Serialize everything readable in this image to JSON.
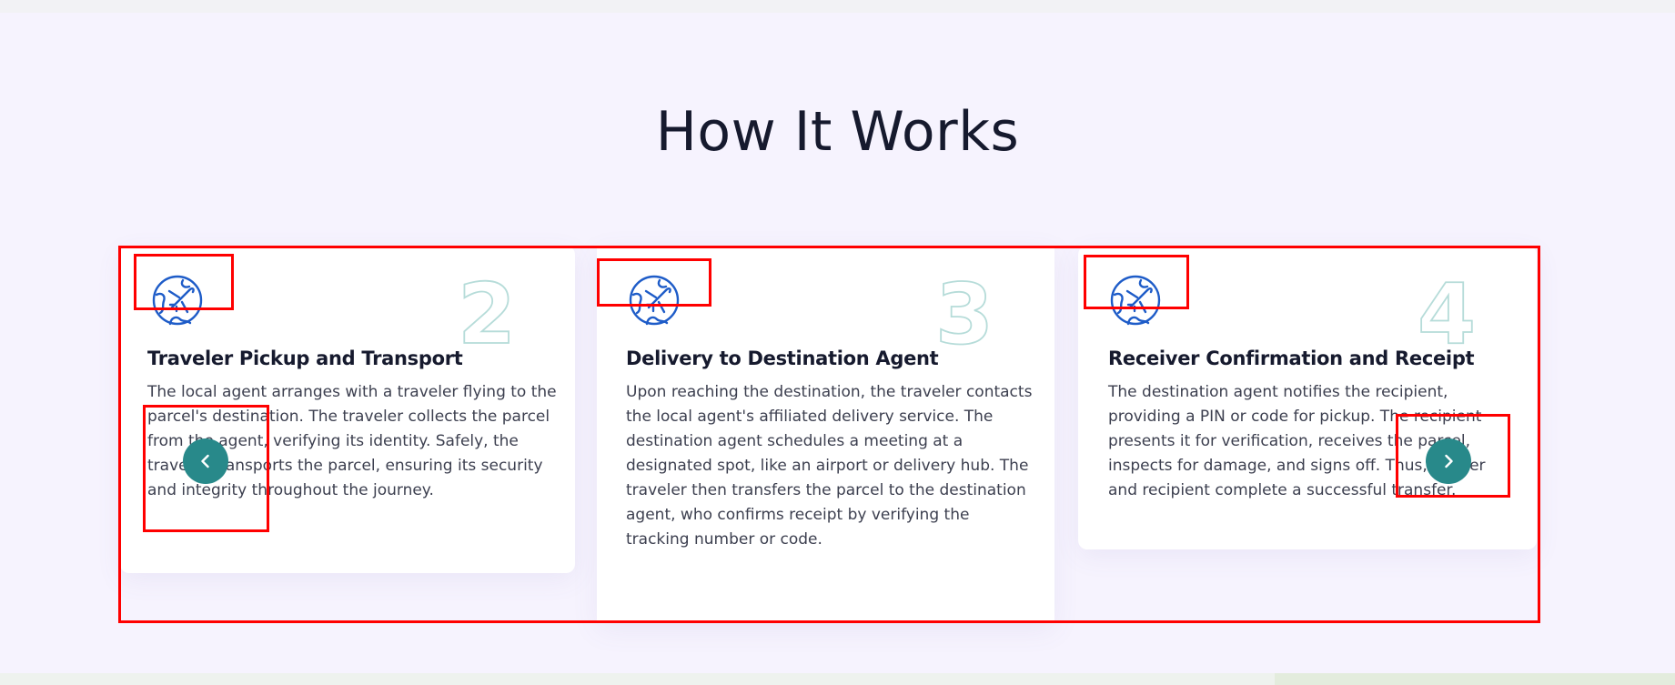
{
  "section": {
    "title": "How It Works"
  },
  "steps": [
    {
      "number": "2",
      "title": "Traveler Pickup and Transport",
      "description": "The local agent arranges with a traveler flying to the parcel's destination. The traveler collects the parcel from the agent, verifying its identity. Safely, the traveler transports the parcel, ensuring its security and integrity throughout the journey.",
      "icon": "globe-plane-icon"
    },
    {
      "number": "3",
      "title": "Delivery to Destination Agent",
      "description": "Upon reaching the destination, the traveler contacts the local agent's affiliated delivery service. The destination agent schedules a meeting at a designated spot, like an airport or delivery hub. The traveler then transfers the parcel to the destination agent, who confirms receipt by verifying the tracking number or code.",
      "icon": "globe-plane-icon"
    },
    {
      "number": "4",
      "title": "Receiver Confirmation and Receipt",
      "description": "The destination agent notifies the recipient, providing a PIN or code for pickup. The recipient presents it for verification, receives the parcel, inspects for damage, and signs off. Thus, sender and recipient complete a successful transfer.",
      "icon": "globe-plane-icon"
    }
  ],
  "carousel": {
    "prev_icon": "chevron-left-icon",
    "next_icon": "chevron-right-icon"
  },
  "colors": {
    "accent": "#28898a",
    "icon_blue": "#1e5cc8",
    "number_outline": "#b6dcd9",
    "heading": "#161a2e",
    "annotation": "#ff0000"
  }
}
